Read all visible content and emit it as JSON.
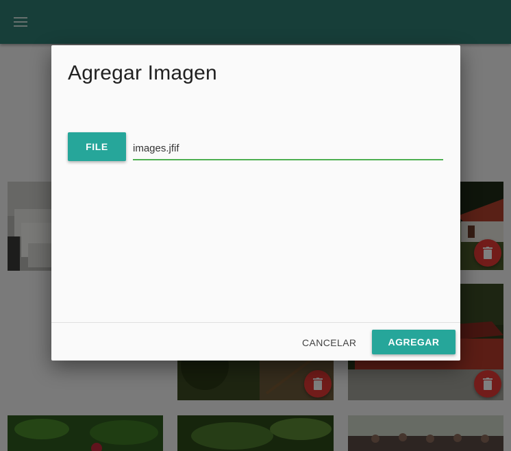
{
  "app_bar": {
    "color": "#2e7d72",
    "menu_icon": "menu-icon"
  },
  "gallery": {
    "tiles": [
      {
        "name": "lab-equipment"
      },
      {
        "name": "red-roof-house"
      },
      {
        "name": "forest-path"
      },
      {
        "name": "red-building"
      },
      {
        "name": "red-flower-plants"
      },
      {
        "name": "green-plants"
      },
      {
        "name": "group-photo"
      }
    ],
    "delete_icon": "trash-icon",
    "delete_color": "#e53935"
  },
  "dialog": {
    "title": "Agregar Imagen",
    "file_button_label": "FILE",
    "file_path_value": "images.jfif",
    "cancel_label": "CANCELAR",
    "submit_label": "AGREGAR",
    "accent_color": "#26a69a"
  }
}
